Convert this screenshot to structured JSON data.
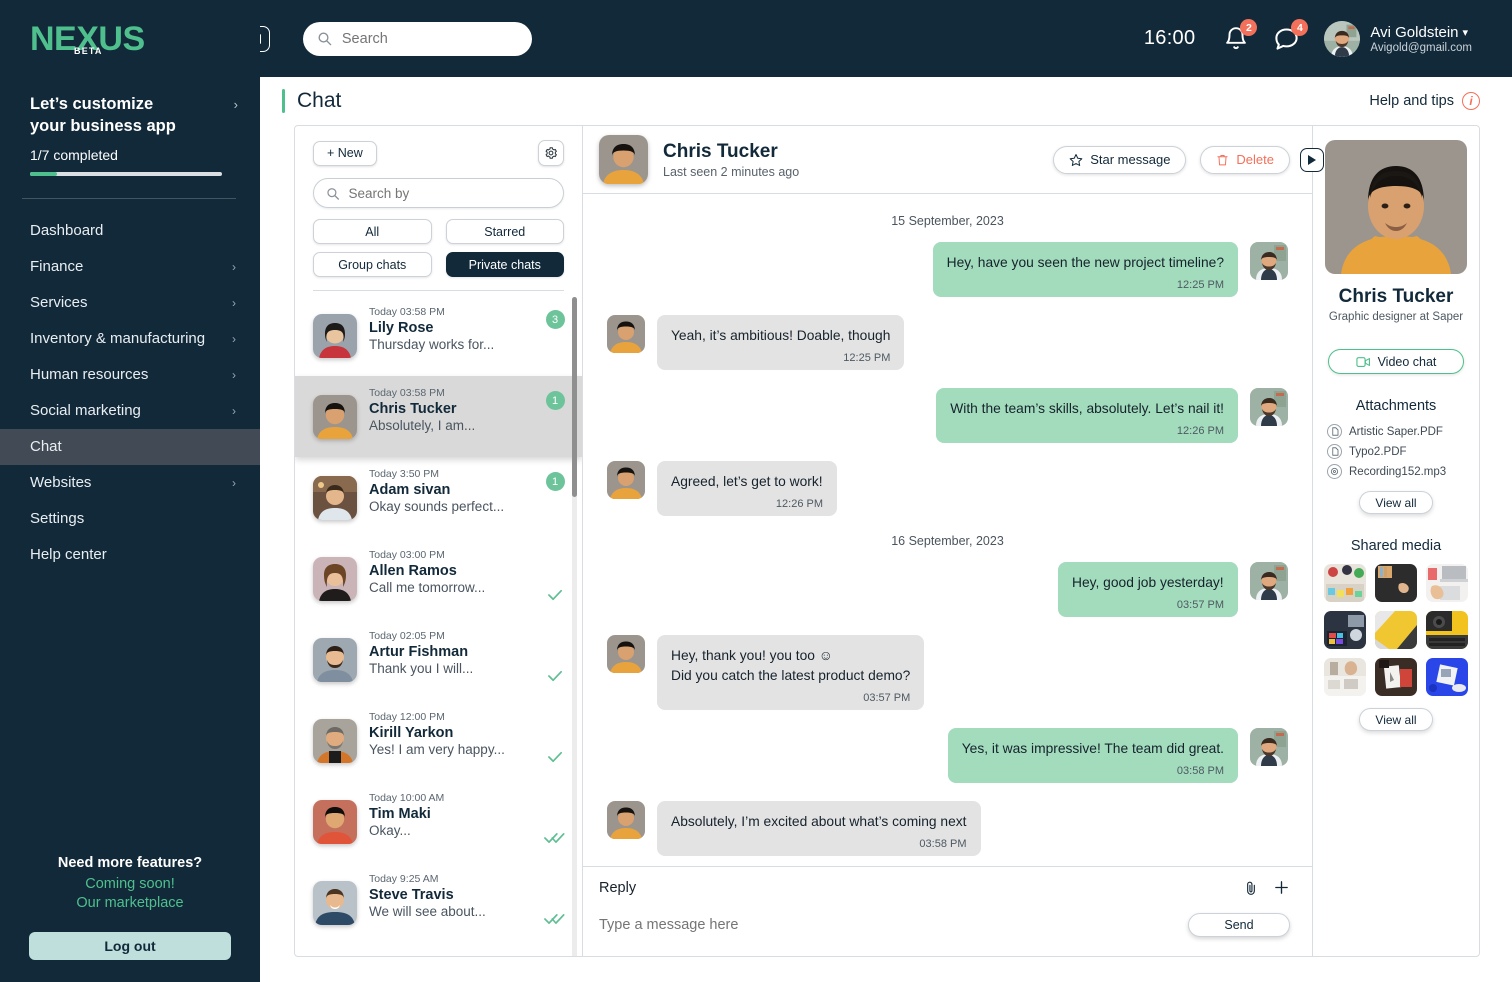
{
  "brand": {
    "name": "NEXUS",
    "tag": "BETA",
    "accent": "#4fc08d",
    "dark": "#12293a"
  },
  "onboarding": {
    "title_line1": "Let’s customize",
    "title_line2": "your business app",
    "progress_label": "1/7 completed",
    "progress_percent": 14
  },
  "sidebar": {
    "items": [
      {
        "label": "Dashboard",
        "chevron": false,
        "active": false
      },
      {
        "label": "Finance",
        "chevron": true,
        "active": false
      },
      {
        "label": "Services",
        "chevron": true,
        "active": false
      },
      {
        "label": "Inventory & manufacturing",
        "chevron": true,
        "active": false
      },
      {
        "label": "Human resources",
        "chevron": true,
        "active": false
      },
      {
        "label": "Social marketing",
        "chevron": true,
        "active": false
      },
      {
        "label": "Chat",
        "chevron": false,
        "active": true
      },
      {
        "label": "Websites",
        "chevron": true,
        "active": false
      },
      {
        "label": "Settings",
        "chevron": false,
        "active": false
      },
      {
        "label": "Help center",
        "chevron": false,
        "active": false
      }
    ],
    "footer": {
      "question": "Need more features?",
      "coming_soon": "Coming soon!",
      "marketplace": "Our marketplace",
      "logout": "Log out"
    }
  },
  "topbar": {
    "search_placeholder": "Search",
    "search_value": "",
    "clock": "16:00",
    "notifications_count": "2",
    "messages_count": "4",
    "user_name": "Avi Goldstein",
    "user_email": "Avigold@gmail.com"
  },
  "page": {
    "title": "Chat",
    "help_label": "Help and tips"
  },
  "chat_list": {
    "new_label": "+ New",
    "search_placeholder": "Search by",
    "search_value": "",
    "filters": [
      {
        "label": "All",
        "active": false
      },
      {
        "label": "Starred",
        "active": false
      },
      {
        "label": "Group chats",
        "active": false
      },
      {
        "label": "Private chats",
        "active": true
      }
    ],
    "items": [
      {
        "time": "Today 03:58 PM",
        "name": "Lily Rose",
        "preview": "Thursday works for...",
        "unread": "3",
        "status": "",
        "selected": false
      },
      {
        "time": "Today 03:58 PM",
        "name": "Chris Tucker",
        "preview": "Absolutely, I am...",
        "unread": "1",
        "status": "",
        "selected": true
      },
      {
        "time": "Today 3:50 PM",
        "name": "Adam sivan",
        "preview": "Okay sounds perfect...",
        "unread": "1",
        "status": "",
        "selected": false
      },
      {
        "time": "Today 03:00 PM",
        "name": "Allen Ramos",
        "preview": "Call me tomorrow...",
        "unread": "",
        "status": "sent",
        "selected": false
      },
      {
        "time": "Today 02:05 PM",
        "name": "Artur Fishman",
        "preview": "Thank you I will...",
        "unread": "",
        "status": "sent",
        "selected": false
      },
      {
        "time": "Today 12:00 PM",
        "name": "Kirill Yarkon",
        "preview": "Yes! I am very happy...",
        "unread": "",
        "status": "sent",
        "selected": false
      },
      {
        "time": "Today 10:00 AM",
        "name": "Tim Maki",
        "preview": "Okay...",
        "unread": "",
        "status": "read",
        "selected": false
      },
      {
        "time": "Today 9:25 AM",
        "name": "Steve Travis",
        "preview": "We will see about...",
        "unread": "",
        "status": "read",
        "selected": false
      }
    ]
  },
  "conversation": {
    "contact_name": "Chris Tucker",
    "contact_status": "Last seen 2 minutes ago",
    "star_label": "Star message",
    "delete_label": "Delete",
    "groups": [
      {
        "date": "15 September, 2023",
        "messages": [
          {
            "dir": "out",
            "text": "Hey, have you seen the new project timeline?",
            "time": "12:25 PM"
          },
          {
            "dir": "in",
            "text": "Yeah, it’s ambitious! Doable, though",
            "time": "12:25 PM"
          },
          {
            "dir": "out",
            "text": "With the team’s skills, absolutely. Let’s nail it!",
            "time": "12:26 PM"
          },
          {
            "dir": "in",
            "text": "Agreed, let’s get to work!",
            "time": "12:26 PM"
          }
        ]
      },
      {
        "date": "16 September, 2023",
        "messages": [
          {
            "dir": "out",
            "text": "Hey, good job yesterday!",
            "time": "03:57 PM"
          },
          {
            "dir": "in",
            "text": "Hey, thank you! you too ☺\nDid you catch the latest product demo?",
            "time": "03:57 PM"
          },
          {
            "dir": "out",
            "text": "Yes, it was impressive! The team did great.",
            "time": "03:58 PM"
          },
          {
            "dir": "in",
            "text": "Absolutely, I’m excited about what’s coming next",
            "time": "03:58 PM"
          }
        ]
      }
    ],
    "reply_label": "Reply",
    "reply_placeholder": "Type a message here",
    "reply_value": "",
    "send_label": "Send"
  },
  "profile": {
    "name": "Chris Tucker",
    "role": "Graphic designer at Saper",
    "video_label": "Video chat",
    "attachments_title": "Attachments",
    "attachments": [
      {
        "name": "Artistic Saper.PDF",
        "kind": "pdf"
      },
      {
        "name": "Typo2.PDF",
        "kind": "pdf"
      },
      {
        "name": "Recording152.mp3",
        "kind": "audio"
      }
    ],
    "attachments_viewall": "View all",
    "media_title": "Shared media",
    "media_viewall": "View all",
    "media_count": 9
  }
}
